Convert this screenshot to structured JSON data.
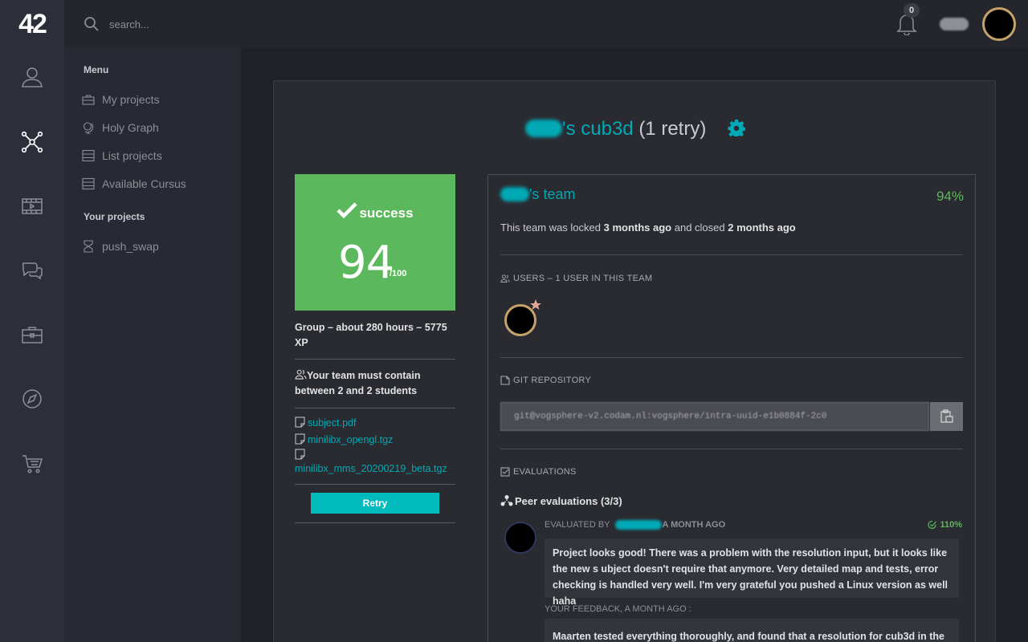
{
  "app": {
    "logo": "42"
  },
  "search": {
    "placeholder": "search..."
  },
  "notifications": {
    "count": "0"
  },
  "sidebar": {
    "menu_heading": "Menu",
    "items": [
      {
        "label": "My projects",
        "icon": "briefcase-icon"
      },
      {
        "label": "Holy Graph",
        "icon": "globe-icon"
      },
      {
        "label": "List projects",
        "icon": "list-icon"
      },
      {
        "label": "Available Cursus",
        "icon": "list-icon"
      }
    ],
    "your_projects_heading": "Your projects",
    "projects": [
      {
        "label": "push_swap",
        "icon": "hourglass-icon"
      }
    ]
  },
  "project": {
    "title_name": "'s cub3d",
    "title_retry": "(1 retry)",
    "status": "success",
    "score": "94",
    "score_max": "/100",
    "group_info": "Group – about 280 hours – 5775 XP",
    "team_info": "Your team must contain between 2 and 2 students",
    "files": [
      "subject.pdf",
      "minilibx_opengl.tgz",
      "minilibx_mms_20200219_beta.tgz"
    ],
    "retry_label": "Retry"
  },
  "team": {
    "name_suffix": "'s team",
    "percent": "94%",
    "status_prefix": "This team was locked ",
    "locked": "3 months ago",
    "status_mid": " and closed ",
    "closed": "2 months ago",
    "users_title": "USERS – 1 USER IN THIS TEAM",
    "git_title": "GIT REPOSITORY",
    "repo_url": "git@vogsphere-v2.codam.nl:vogsphere/intra-uuid-e1b0884f-2c0",
    "evaluations_title": "EVALUATIONS",
    "peer_title": "Peer evaluations (3/3)",
    "evaluation": {
      "by_label": "EVALUATED BY",
      "when": "A MONTH AGO",
      "score": "110%",
      "comment": "Project looks good! There was a problem with the resolution input, but it looks like the new s ubject doesn't require that anymore. Very detailed map and tests, error checking is handled very well. I'm very grateful you pushed a Linux version as well haha",
      "feedback_label": "YOUR FEEDBACK, A MONTH AGO :",
      "feedback": "Maarten tested everything thoroughly, and found that a resolution for cub3d in the .cub con"
    }
  },
  "colors": {
    "accent": "#00a9b5",
    "success": "#5cb85c",
    "panel": "#2a2b31",
    "rail": "#2c2f3a"
  }
}
